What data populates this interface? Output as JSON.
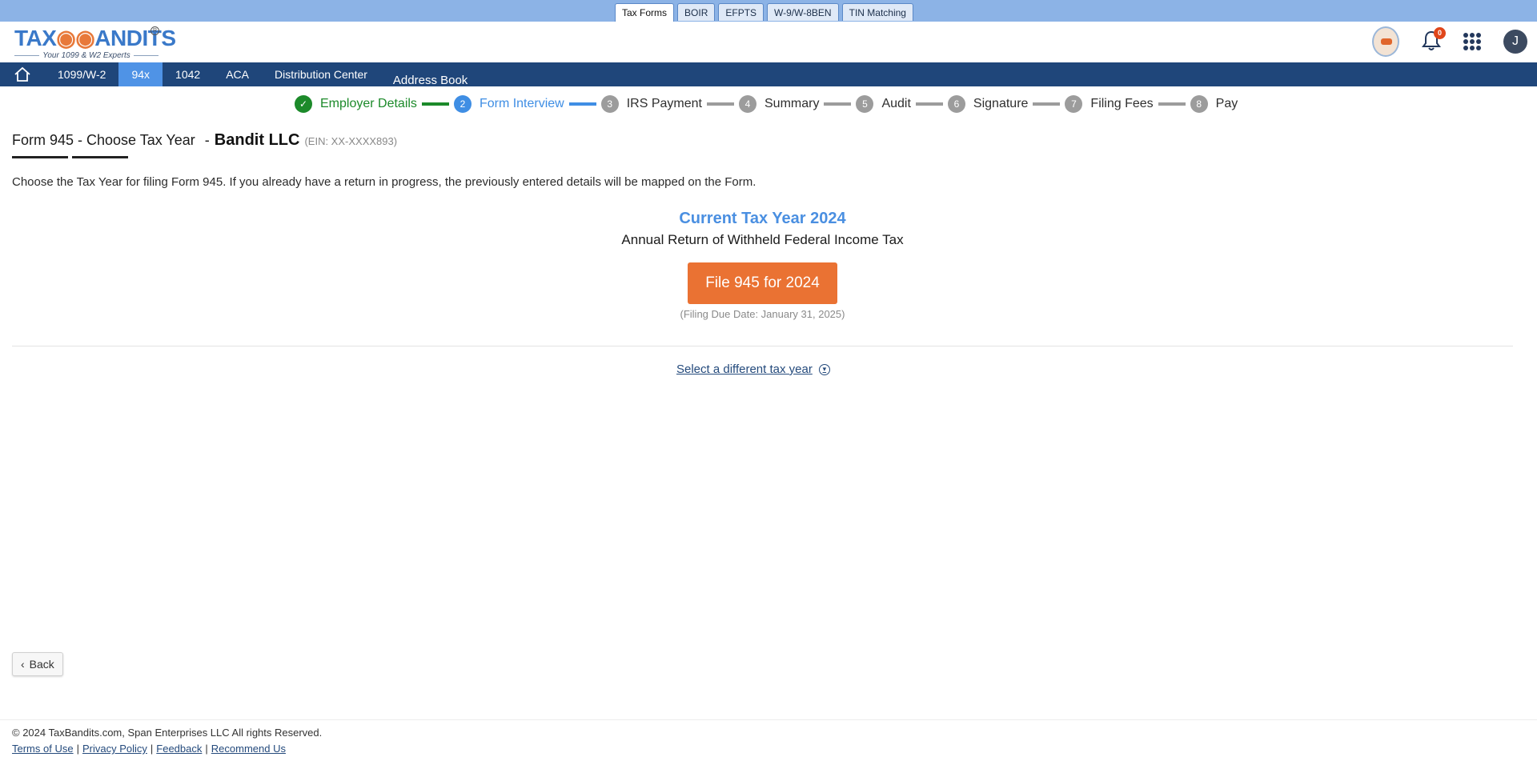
{
  "product_tabs": [
    {
      "label": "Tax Forms",
      "active": true
    },
    {
      "label": "BOIR"
    },
    {
      "label": "EFPTS"
    },
    {
      "label": "W-9/W-8BEN"
    },
    {
      "label": "TIN Matching"
    }
  ],
  "logo": {
    "main_a": "TAX",
    "main_b": "ANDITS",
    "reg": "R",
    "tagline": "Your 1099 & W2 Experts"
  },
  "notifications": {
    "count": "0"
  },
  "user": {
    "initial": "J"
  },
  "nav": {
    "items": [
      "1099/W-2",
      "94x",
      "1042",
      "ACA",
      "Distribution Center"
    ],
    "active": "94x",
    "address_book": "Address Book"
  },
  "stepper": {
    "steps": [
      {
        "number": "✓",
        "label": "Employer Details",
        "state": "done"
      },
      {
        "number": "2",
        "label": "Form Interview",
        "state": "current"
      },
      {
        "number": "3",
        "label": "IRS Payment"
      },
      {
        "number": "4",
        "label": "Summary"
      },
      {
        "number": "5",
        "label": "Audit"
      },
      {
        "number": "6",
        "label": "Signature"
      },
      {
        "number": "7",
        "label": "Filing Fees"
      },
      {
        "number": "8",
        "label": "Pay"
      }
    ]
  },
  "page": {
    "form_title": "Form 945 - Choose Tax Year",
    "dash": "-",
    "company": "Bandit LLC",
    "ein": "(EIN: XX-XXXX893)",
    "description": "Choose the Tax Year for filing Form 945. If you already have a return in progress, the previously entered details will be mapped on the Form.",
    "current_year": "Current Tax Year 2024",
    "annual_return": "Annual Return of Withheld Federal Income Tax",
    "file_button": "File 945 for 2024",
    "due_date": "(Filing Due Date: January 31, 2025)",
    "different_year": "Select a different tax year",
    "back": "Back"
  },
  "footer": {
    "copyright": "© 2024 TaxBandits.com, Span Enterprises LLC All rights Reserved.",
    "links": [
      "Terms of Use",
      "Privacy Policy",
      "Feedback",
      "Recommend Us"
    ],
    "separator": "|"
  },
  "colors": {
    "accent": "#ea7233",
    "nav": "#1f467a",
    "done": "#1c8a2a",
    "current": "#3f8ee4"
  }
}
